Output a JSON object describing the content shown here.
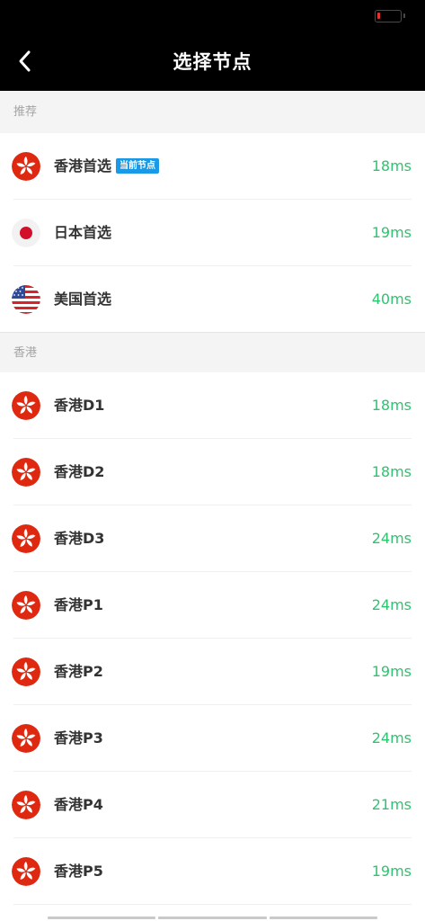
{
  "header": {
    "title": "选择节点",
    "back_icon": "chevron-left-icon"
  },
  "sections": [
    {
      "title": "推荐",
      "rows": [
        {
          "flag": "hong-kong-flag-icon",
          "name": "香港首选",
          "badge": "当前节点",
          "latency": "18ms"
        },
        {
          "flag": "japan-flag-icon",
          "name": "日本首选",
          "latency": "19ms"
        },
        {
          "flag": "usa-flag-icon",
          "name": "美国首选",
          "latency": "40ms"
        }
      ]
    },
    {
      "title": "香港",
      "rows": [
        {
          "flag": "hong-kong-flag-icon",
          "name": "香港D1",
          "latency": "18ms"
        },
        {
          "flag": "hong-kong-flag-icon",
          "name": "香港D2",
          "latency": "18ms"
        },
        {
          "flag": "hong-kong-flag-icon",
          "name": "香港D3",
          "latency": "24ms"
        },
        {
          "flag": "hong-kong-flag-icon",
          "name": "香港P1",
          "latency": "24ms"
        },
        {
          "flag": "hong-kong-flag-icon",
          "name": "香港P2",
          "latency": "19ms"
        },
        {
          "flag": "hong-kong-flag-icon",
          "name": "香港P3",
          "latency": "24ms"
        },
        {
          "flag": "hong-kong-flag-icon",
          "name": "香港P4",
          "latency": "21ms"
        },
        {
          "flag": "hong-kong-flag-icon",
          "name": "香港P5",
          "latency": "19ms"
        }
      ]
    }
  ],
  "colors": {
    "header_bg": "#000000",
    "latency_green": "#2cc56f",
    "badge_blue": "#1a9ae6",
    "hk_red": "#de2910",
    "section_bg": "#f4f4f4"
  },
  "status_bar": {
    "battery_icon": "battery-low-icon",
    "battery_level": 0.1
  }
}
